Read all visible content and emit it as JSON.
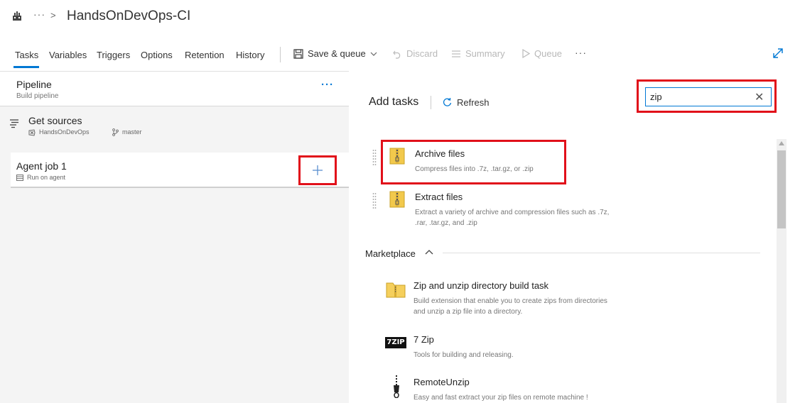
{
  "header": {
    "breadcrumb_more": "···",
    "pipeline_title": "HandsOnDevOps-CI"
  },
  "tabs": [
    {
      "label": "Tasks"
    },
    {
      "label": "Variables"
    },
    {
      "label": "Triggers"
    },
    {
      "label": "Options"
    },
    {
      "label": "Retention"
    },
    {
      "label": "History"
    }
  ],
  "toolbar": {
    "save_queue": "Save & queue",
    "discard": "Discard",
    "summary": "Summary",
    "queue": "Queue",
    "more": "···"
  },
  "left": {
    "pipeline_label": "Pipeline",
    "pipeline_sub": "Build pipeline",
    "pipeline_more": "···",
    "get_sources": "Get sources",
    "repo": "HandsOnDevOps",
    "branch": "master",
    "agent_job": "Agent job 1",
    "agent_sub": "Run on agent"
  },
  "right": {
    "title": "Add tasks",
    "refresh": "Refresh",
    "search_value": "zip",
    "tasks": [
      {
        "title": "Archive files",
        "desc": "Compress files into .7z, .tar.gz, or .zip"
      },
      {
        "title": "Extract files",
        "desc": "Extract a variety of archive and compression files such as .7z, .rar, .tar.gz, and .zip"
      }
    ],
    "marketplace_label": "Marketplace",
    "marketplace": [
      {
        "title": "Zip and unzip directory build task",
        "desc": "Build extension that enable you to create zips from directories and unzip a zip file into a directory."
      },
      {
        "title": "7 Zip",
        "desc": "Tools for building and releasing.",
        "icon_text": "7ZIP"
      },
      {
        "title": "RemoteUnzip",
        "desc": "Easy and fast extract your zip files on remote machine !"
      }
    ]
  },
  "colors": {
    "accent": "#0078d4",
    "highlight": "#e1101a"
  }
}
